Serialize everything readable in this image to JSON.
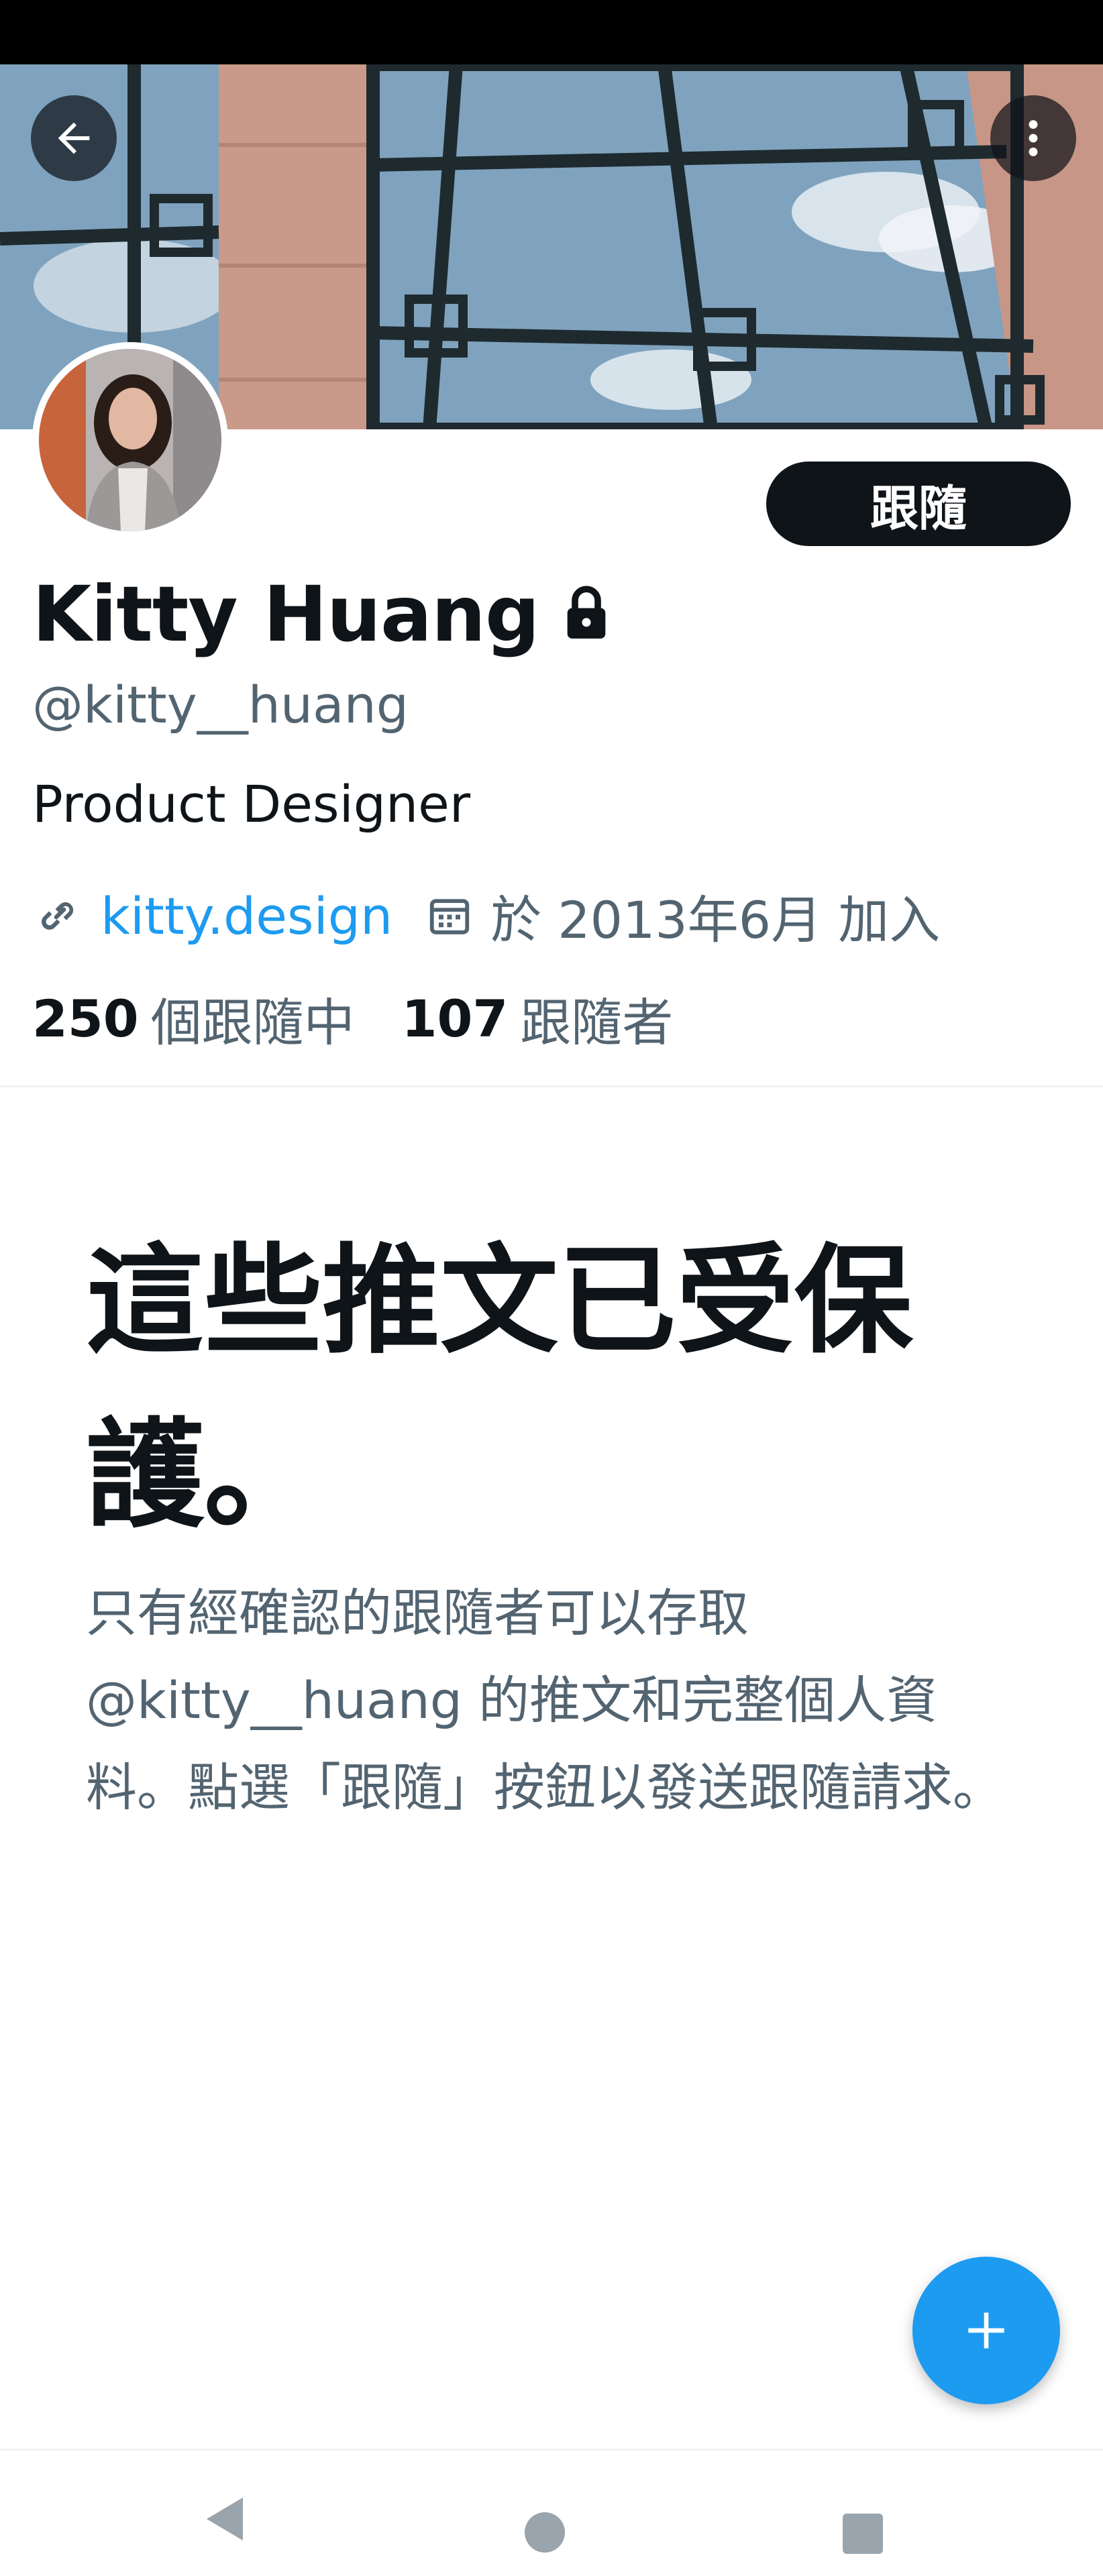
{
  "profile": {
    "display_name": "Kitty Huang",
    "handle": "@kitty__huang",
    "bio": "Product Designer",
    "website": "kitty.design",
    "joined": "於 2013年6月 加入",
    "following_count": "250",
    "following_label": "個跟隨中",
    "followers_count": "107",
    "followers_label": "跟隨者",
    "protected": true
  },
  "header": {
    "back_icon": "arrow-left-icon",
    "more_icon": "more-vertical-icon",
    "follow_label": "跟隨"
  },
  "protected_notice": {
    "title": "這些推文已受保護。",
    "description": "只有經確認的跟隨者可以存取 @kitty__huang 的推文和完整個人資料。點選「跟隨」按鈕以發送跟隨請求。"
  },
  "fab": {
    "icon": "plus-icon"
  },
  "system_nav": {
    "back_icon": "triangle-back-icon",
    "home_icon": "circle-home-icon",
    "recents_icon": "square-recents-icon"
  },
  "colors": {
    "accent": "#1d9bf0",
    "text_primary": "#0f1419",
    "text_secondary": "#536471",
    "follow_button": "#0f1419"
  }
}
